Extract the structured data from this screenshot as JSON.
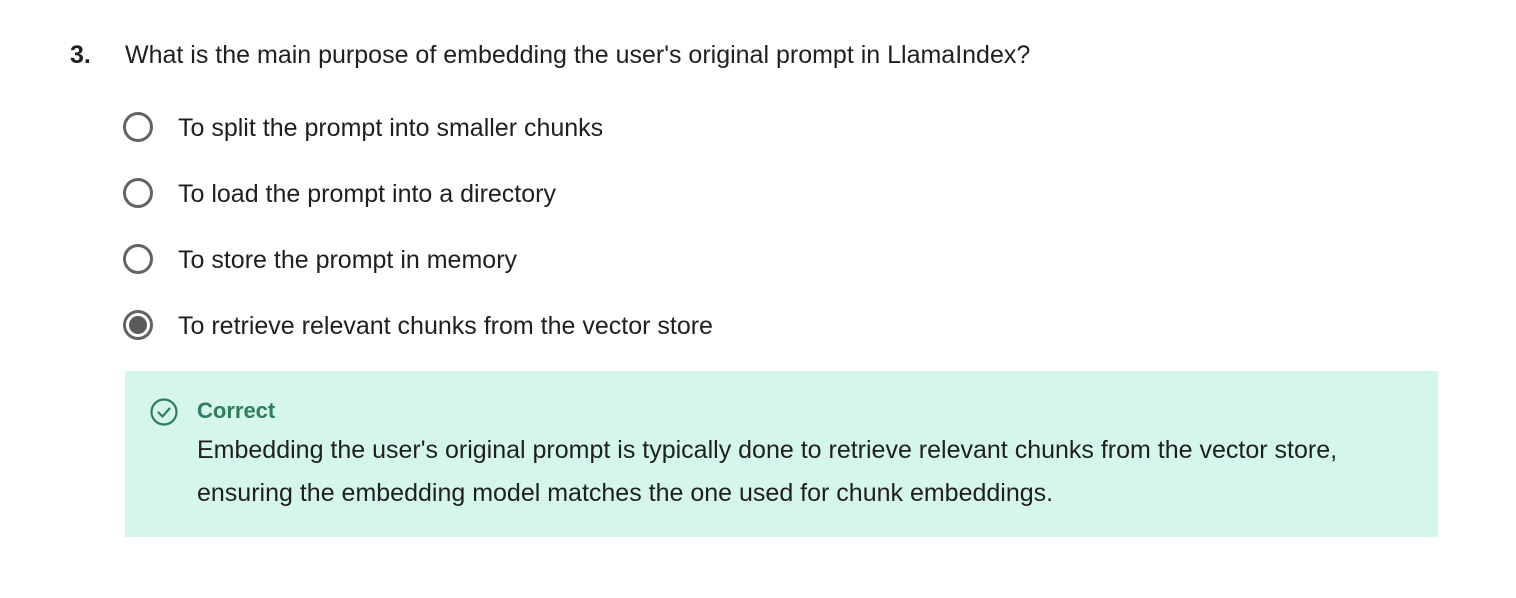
{
  "question": {
    "number": "3.",
    "text": "What is the main purpose of embedding the user's original prompt in LlamaIndex?"
  },
  "options": [
    {
      "label": "To split the prompt into smaller chunks",
      "selected": false
    },
    {
      "label": "To load the prompt into a directory",
      "selected": false
    },
    {
      "label": "To store the prompt in memory",
      "selected": false
    },
    {
      "label": "To retrieve relevant chunks from the vector store",
      "selected": true
    }
  ],
  "feedback": {
    "icon": "check-circle-icon",
    "status": "Correct",
    "explanation": "Embedding the user's original prompt is typically done to retrieve relevant chunks from the vector store, ensuring the embedding model matches the one used for chunk embeddings.",
    "colors": {
      "background": "#d5f6ea",
      "accent": "#2e7d5b"
    }
  }
}
